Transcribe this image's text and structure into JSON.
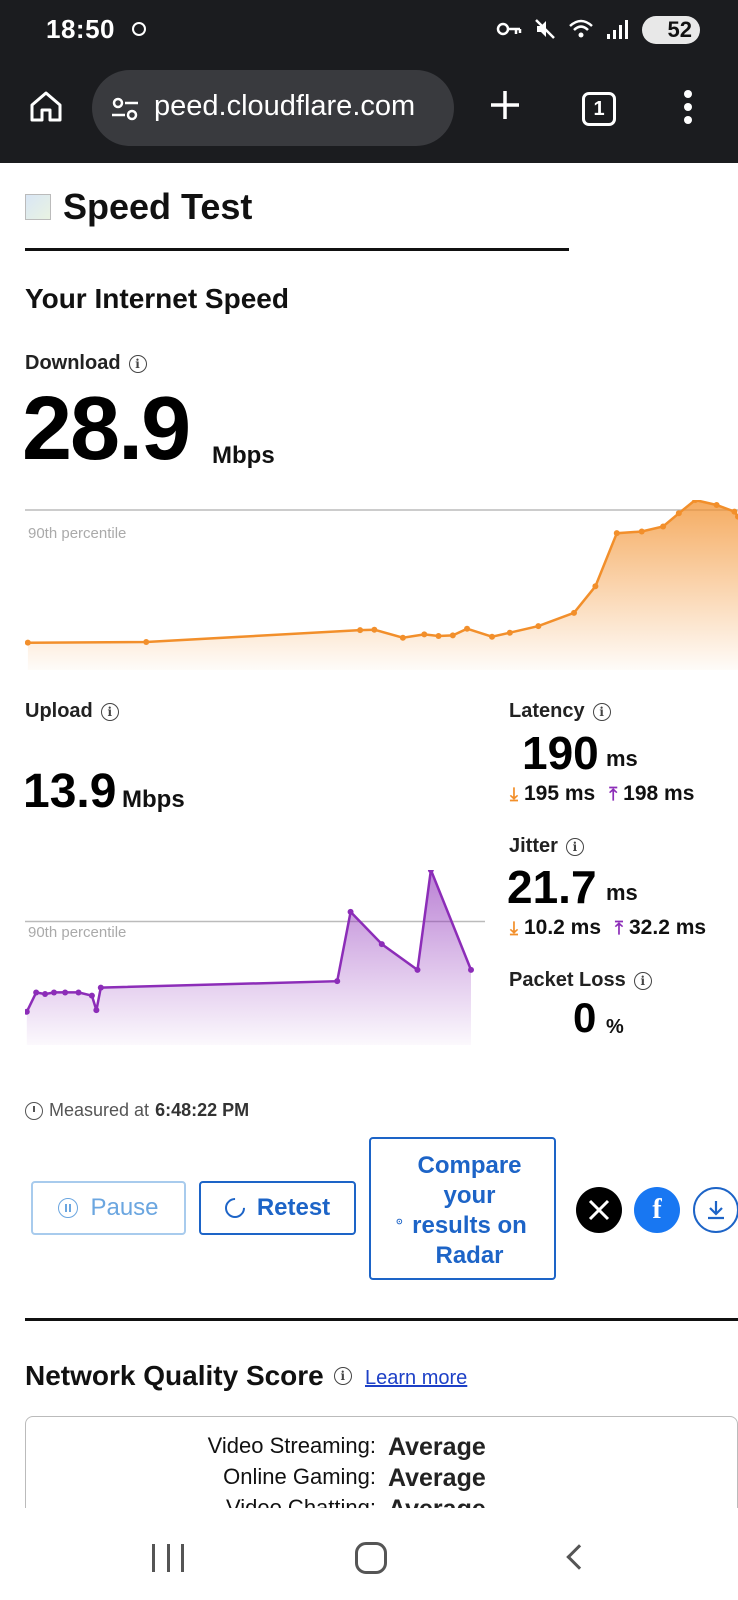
{
  "status_bar": {
    "time": "18:50",
    "battery": "52"
  },
  "browser": {
    "url": "peed.cloudflare.com",
    "tab_count": "1"
  },
  "page": {
    "title": "Speed Test",
    "section_title": "Your Internet Speed"
  },
  "download": {
    "label": "Download",
    "value": "28.9",
    "unit": "Mbps",
    "percentile_label": "90th percentile"
  },
  "upload": {
    "label": "Upload",
    "value": "13.9",
    "unit": "Mbps",
    "percentile_label": "90th percentile"
  },
  "latency": {
    "label": "Latency",
    "value": "190",
    "unit": "ms",
    "down": "195 ms",
    "up": "198 ms"
  },
  "jitter": {
    "label": "Jitter",
    "value": "21.7",
    "unit": "ms",
    "down": "10.2 ms",
    "up": "32.2 ms"
  },
  "packet_loss": {
    "label": "Packet Loss",
    "value": "0",
    "unit": "%"
  },
  "measured": {
    "prefix": "Measured at",
    "time": "6:48:22 PM"
  },
  "buttons": {
    "pause": "Pause",
    "retest": "Retest",
    "radar_line1": "Compare",
    "radar_line2": "your",
    "radar_line3": "results on",
    "radar_line4": "Radar"
  },
  "network_quality": {
    "title": "Network Quality Score",
    "learn_more": "Learn more",
    "rows": [
      {
        "key": "Video Streaming:",
        "value": "Average"
      },
      {
        "key": "Online Gaming:",
        "value": "Average"
      },
      {
        "key": "Video Chatting:",
        "value": "Average"
      }
    ]
  },
  "colors": {
    "download": "#f28f2b",
    "upload": "#8c2db8",
    "link": "#1d64c7"
  },
  "chart_data": [
    {
      "type": "area",
      "name": "download",
      "y": [
        1,
        1.2,
        4.8,
        4.9,
        2.5,
        3.5,
        3,
        3.2,
        5.2,
        2.8,
        4,
        6,
        10,
        18,
        34,
        34.5,
        36,
        40,
        44,
        42.5,
        40.5,
        39
      ],
      "reference_line": {
        "label": "90th percentile",
        "y": 41
      }
    },
    {
      "type": "area",
      "name": "upload",
      "y": [
        1,
        7,
        6.5,
        7,
        7,
        7,
        6,
        1.5,
        8.5,
        10.5,
        32,
        22,
        14,
        45,
        14
      ],
      "reference_line": {
        "label": "90th percentile",
        "y": 29
      }
    }
  ]
}
